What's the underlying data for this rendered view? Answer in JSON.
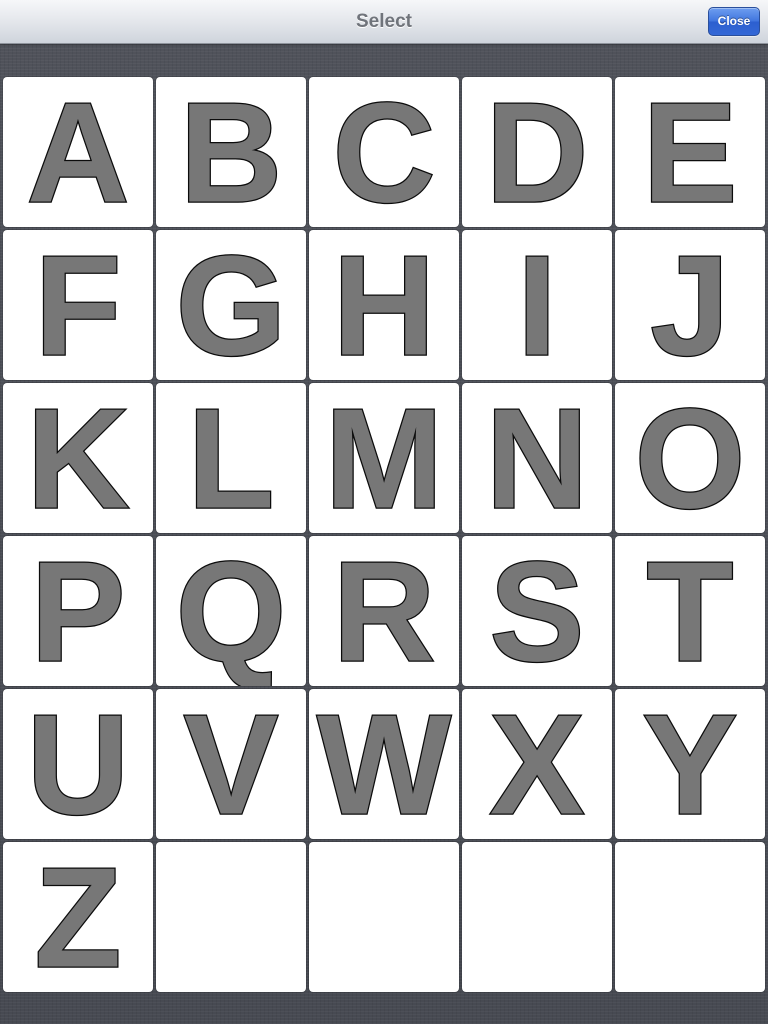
{
  "navbar": {
    "title": "Select",
    "close_label": "Close"
  },
  "letters": [
    "A",
    "B",
    "C",
    "D",
    "E",
    "F",
    "G",
    "H",
    "I",
    "J",
    "K",
    "L",
    "M",
    "N",
    "O",
    "P",
    "Q",
    "R",
    "S",
    "T",
    "U",
    "V",
    "W",
    "X",
    "Y",
    "Z"
  ],
  "empty_tiles": 4,
  "colors": {
    "tile_background": "#ffffff",
    "letter_fill": "#777777",
    "letter_outline": "#0c0c0c",
    "close_button": "#3f74de"
  }
}
